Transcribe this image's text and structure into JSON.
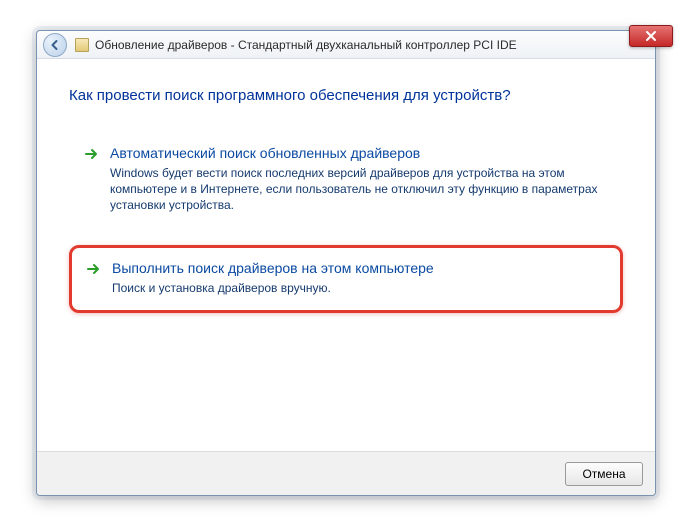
{
  "titlebar": {
    "title": "Обновление драйверов - Стандартный двухканальный контроллер PCI IDE"
  },
  "heading": "Как провести поиск программного обеспечения для устройств?",
  "options": [
    {
      "title": "Автоматический поиск обновленных драйверов",
      "desc": "Windows будет вести поиск последних версий драйверов для устройства на этом компьютере и в Интернете, если пользователь не отключил эту функцию в параметрах установки устройства."
    },
    {
      "title": "Выполнить поиск драйверов на этом компьютере",
      "desc": "Поиск и установка драйверов вручную."
    }
  ],
  "buttons": {
    "cancel": "Отмена"
  }
}
